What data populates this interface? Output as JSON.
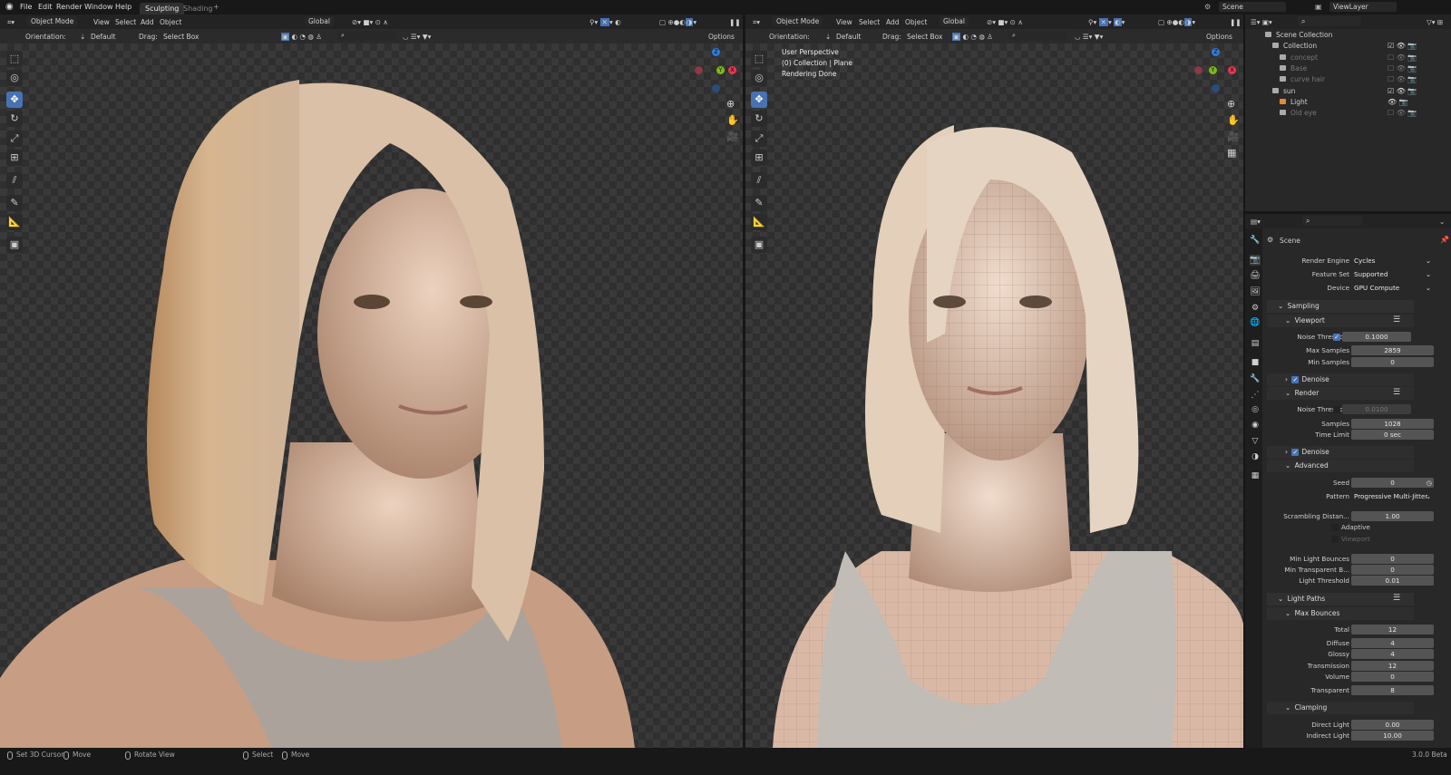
{
  "topbar": {
    "menus": [
      "File",
      "Edit",
      "Render",
      "Window",
      "Help"
    ],
    "workspace_tabs": [
      "Sculpting",
      "Shading"
    ],
    "add_tab": "+",
    "scene": "Scene",
    "view_layer": "ViewLayer"
  },
  "viewport_left": {
    "mode": "Object Mode",
    "menus": [
      "View",
      "Select",
      "Add",
      "Object"
    ],
    "transform": "Global",
    "orientation_label": "Orientation:",
    "orientation": "Default",
    "drag_label": "Drag:",
    "drag": "Select Box",
    "options": "Options"
  },
  "viewport_right": {
    "mode": "Object Mode",
    "menus": [
      "View",
      "Select",
      "Add",
      "Object"
    ],
    "transform": "Global",
    "orientation_label": "Orientation:",
    "orientation": "Default",
    "drag_label": "Drag:",
    "drag": "Select Box",
    "options": "Options",
    "overlay": [
      "User Perspective",
      "(0) Collection | Plane",
      "Rendering Done"
    ]
  },
  "gizmo": {
    "z": "Z",
    "y": "Y",
    "x": "X",
    "colors": {
      "x": "#e6374f",
      "y": "#7fb619",
      "z": "#2f7bd9"
    }
  },
  "outliner": {
    "items": [
      {
        "label": "Scene Collection",
        "dim": false
      },
      {
        "label": "Collection",
        "dim": false
      },
      {
        "label": "concept",
        "dim": true
      },
      {
        "label": "Base",
        "dim": true
      },
      {
        "label": "curve hair",
        "dim": true
      },
      {
        "label": "sun",
        "dim": false
      },
      {
        "label": "Light",
        "dim": false
      },
      {
        "label": "Old eye",
        "dim": true
      }
    ]
  },
  "properties": {
    "context": "Scene",
    "rows": [
      {
        "type": "field",
        "label": "Render Engine",
        "value": "Cycles",
        "kind": "select"
      },
      {
        "type": "field",
        "label": "Feature Set",
        "value": "Supported",
        "kind": "select"
      },
      {
        "type": "field",
        "label": "Device",
        "value": "GPU Compute",
        "kind": "select"
      },
      {
        "type": "section",
        "label": "Sampling"
      },
      {
        "type": "sub",
        "label": "Viewport"
      },
      {
        "type": "field",
        "label": "Noise Threshold",
        "value": "0.1000",
        "checked": true
      },
      {
        "type": "field",
        "label": "Max Samples",
        "value": "2859"
      },
      {
        "type": "field",
        "label": "Min Samples",
        "value": "0"
      },
      {
        "type": "sub",
        "label": "Denoise",
        "checked": true
      },
      {
        "type": "sub",
        "label": "Render"
      },
      {
        "type": "field",
        "label": "Noise Threshold",
        "value": "0.0100",
        "checked": false,
        "disabled": true
      },
      {
        "type": "field",
        "label": "Samples",
        "value": "1028"
      },
      {
        "type": "field",
        "label": "Time Limit",
        "value": "0 sec"
      },
      {
        "type": "sub",
        "label": "Denoise",
        "checked": true
      },
      {
        "type": "sub",
        "label": "Advanced"
      },
      {
        "type": "field",
        "label": "Seed",
        "value": "0"
      },
      {
        "type": "field",
        "label": "Pattern",
        "value": "Progressive Multi-Jitter",
        "kind": "select"
      },
      {
        "type": "field",
        "label": "Scrambling Distan...",
        "value": "1.00"
      },
      {
        "type": "check",
        "label": "Adaptive",
        "checked": false
      },
      {
        "type": "check",
        "label": "Viewport",
        "checked": false,
        "disabled": true
      },
      {
        "type": "field",
        "label": "Min Light Bounces",
        "value": "0"
      },
      {
        "type": "field",
        "label": "Min Transparent B...",
        "value": "0"
      },
      {
        "type": "field",
        "label": "Light Threshold",
        "value": "0.01"
      },
      {
        "type": "section",
        "label": "Light Paths"
      },
      {
        "type": "sub",
        "label": "Max Bounces"
      },
      {
        "type": "field",
        "label": "Total",
        "value": "12"
      },
      {
        "type": "field",
        "label": "Diffuse",
        "value": "4"
      },
      {
        "type": "field",
        "label": "Glossy",
        "value": "4"
      },
      {
        "type": "field",
        "label": "Transmission",
        "value": "12"
      },
      {
        "type": "field",
        "label": "Volume",
        "value": "0"
      },
      {
        "type": "field",
        "label": "Transparent",
        "value": "8"
      },
      {
        "type": "sub",
        "label": "Clamping"
      },
      {
        "type": "field",
        "label": "Direct Light",
        "value": "0.00"
      },
      {
        "type": "field",
        "label": "Indirect Light",
        "value": "10.00"
      }
    ]
  },
  "status": {
    "items": [
      "Set 3D Cursor",
      "Move",
      "Rotate View",
      "Select",
      "Move"
    ],
    "version": "3.0.0 Beta"
  }
}
